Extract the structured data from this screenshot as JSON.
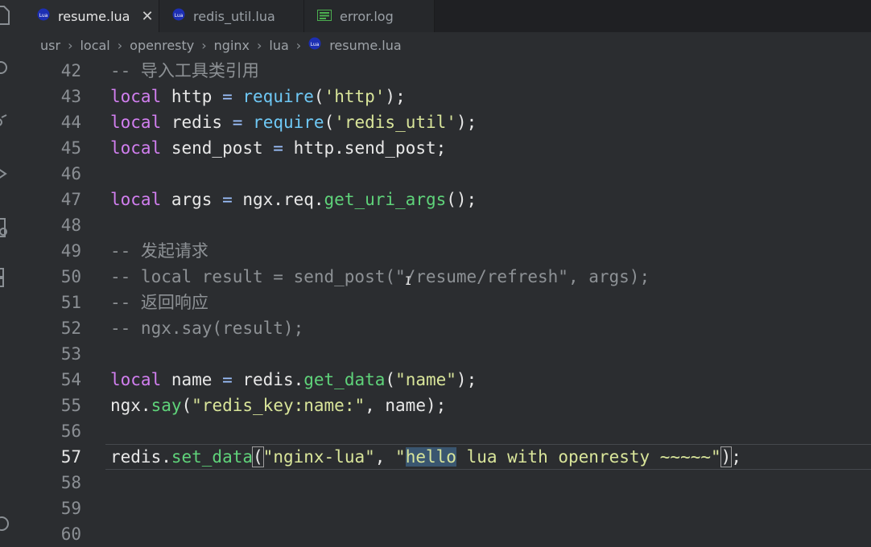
{
  "tabs": [
    {
      "label": "resume.lua",
      "icon": "lua-file-icon",
      "active": true
    },
    {
      "label": "redis_util.lua",
      "icon": "lua-file-icon",
      "active": false
    },
    {
      "label": "error.log",
      "icon": "log-file-icon",
      "active": false
    }
  ],
  "breadcrumb": [
    "usr",
    "local",
    "openresty",
    "nginx",
    "lua",
    "resume.lua"
  ],
  "icon_lua_text": "Lua",
  "colors": {
    "keyword": "#d27ff0",
    "function": "#6fc9f6",
    "builtin_call": "#5fd37a",
    "string": "#d9e59a",
    "comment": "#8d9195",
    "selection": "#3a5670"
  },
  "editor": {
    "current_line": 57,
    "lines": [
      {
        "n": "42",
        "parts": [
          {
            "t": "-- 导入工具类引用",
            "c": "cm"
          }
        ]
      },
      {
        "n": "43",
        "parts": [
          {
            "t": "local",
            "c": "kw"
          },
          {
            "t": " http "
          },
          {
            "t": "=",
            "c": "op"
          },
          {
            "t": " "
          },
          {
            "t": "require",
            "c": "fn"
          },
          {
            "t": "("
          },
          {
            "t": "'http'",
            "c": "str"
          },
          {
            "t": ");"
          }
        ]
      },
      {
        "n": "44",
        "parts": [
          {
            "t": "local",
            "c": "kw"
          },
          {
            "t": " redis "
          },
          {
            "t": "=",
            "c": "op"
          },
          {
            "t": " "
          },
          {
            "t": "require",
            "c": "fn"
          },
          {
            "t": "("
          },
          {
            "t": "'redis_util'",
            "c": "str"
          },
          {
            "t": ");"
          }
        ]
      },
      {
        "n": "45",
        "parts": [
          {
            "t": "local",
            "c": "kw"
          },
          {
            "t": " send_post "
          },
          {
            "t": "=",
            "c": "op"
          },
          {
            "t": " http.send_post;"
          }
        ]
      },
      {
        "n": "46",
        "parts": []
      },
      {
        "n": "47",
        "parts": [
          {
            "t": "local",
            "c": "kw"
          },
          {
            "t": " args "
          },
          {
            "t": "=",
            "c": "op"
          },
          {
            "t": " ngx.req."
          },
          {
            "t": "get_uri_args",
            "c": "fng"
          },
          {
            "t": "();"
          }
        ]
      },
      {
        "n": "48",
        "parts": []
      },
      {
        "n": "49",
        "parts": [
          {
            "t": "-- 发起请求",
            "c": "cm"
          }
        ]
      },
      {
        "n": "50",
        "parts": [
          {
            "t": "-- local result = send_post(\"/resume/refresh\", args);",
            "c": "cm"
          }
        ]
      },
      {
        "n": "51",
        "parts": [
          {
            "t": "-- 返回响应",
            "c": "cm"
          }
        ]
      },
      {
        "n": "52",
        "parts": [
          {
            "t": "-- ngx.say(result);",
            "c": "cm"
          }
        ]
      },
      {
        "n": "53",
        "parts": []
      },
      {
        "n": "54",
        "parts": [
          {
            "t": "local",
            "c": "kw"
          },
          {
            "t": " name "
          },
          {
            "t": "=",
            "c": "op"
          },
          {
            "t": " redis."
          },
          {
            "t": "get_data",
            "c": "fng"
          },
          {
            "t": "("
          },
          {
            "t": "\"name\"",
            "c": "str"
          },
          {
            "t": ");"
          }
        ]
      },
      {
        "n": "55",
        "parts": [
          {
            "t": "ngx."
          },
          {
            "t": "say",
            "c": "fng"
          },
          {
            "t": "("
          },
          {
            "t": "\"redis_key:name:\"",
            "c": "str"
          },
          {
            "t": ", name);"
          }
        ]
      },
      {
        "n": "56",
        "parts": []
      },
      {
        "n": "57",
        "parts": [
          {
            "t": "redis."
          },
          {
            "t": "set_data",
            "c": "fng"
          },
          {
            "t": "(",
            "c": "pbox"
          },
          {
            "t": "\"nginx-lua\"",
            "c": "str"
          },
          {
            "t": ", "
          },
          {
            "t": "\"",
            "c": "str"
          },
          {
            "t": "hello",
            "c": "strsel"
          },
          {
            "t": " lua with openresty ~~~~~\"",
            "c": "str"
          },
          {
            "t": ")",
            "c": "pbox"
          },
          {
            "t": ";"
          }
        ]
      },
      {
        "n": "58",
        "parts": []
      },
      {
        "n": "59",
        "parts": []
      },
      {
        "n": "60",
        "parts": []
      }
    ]
  }
}
